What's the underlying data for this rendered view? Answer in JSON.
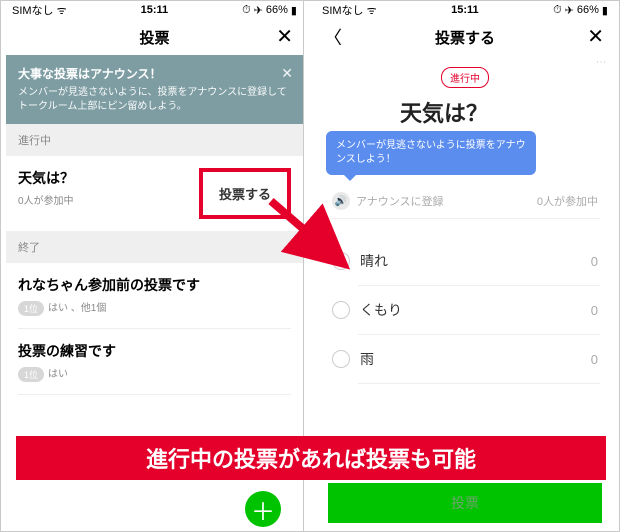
{
  "status": {
    "carrier": "SIMなし",
    "wifi": "⌃",
    "time": "15:11",
    "loc": "➤",
    "battery": "66%"
  },
  "left": {
    "title": "投票",
    "announce": {
      "title": "大事な投票はアナウンス！",
      "body": "メンバーが見逃さないように、投票をアナウンスに登録してトークルーム上部にピン留めしよう。"
    },
    "sec_ongoing": "進行中",
    "sec_ended": "終了",
    "poll1": {
      "title": "天気は？",
      "sub": "0人が参加中",
      "cta": "投票する"
    },
    "poll2": {
      "title": "れなちゃん参加前の投票です",
      "rank": "1位",
      "sub": "はい 、他1個"
    },
    "poll3": {
      "title": "投票の練習です",
      "rank": "1位",
      "sub": "はい"
    }
  },
  "right": {
    "title": "投票する",
    "status_pill": "進行中",
    "poll_title": "天気は？",
    "tooltip": "メンバーが見逃さないように投票をアナウンスしよう！",
    "register": "アナウンスに登録",
    "participants": "0人が参加中",
    "options": [
      {
        "name": "晴れ",
        "count": "0"
      },
      {
        "name": "くもり",
        "count": "0"
      },
      {
        "name": "雨",
        "count": "0"
      }
    ],
    "vote_label": "投票"
  },
  "caption": "進行中の投票があれば投票も可能"
}
